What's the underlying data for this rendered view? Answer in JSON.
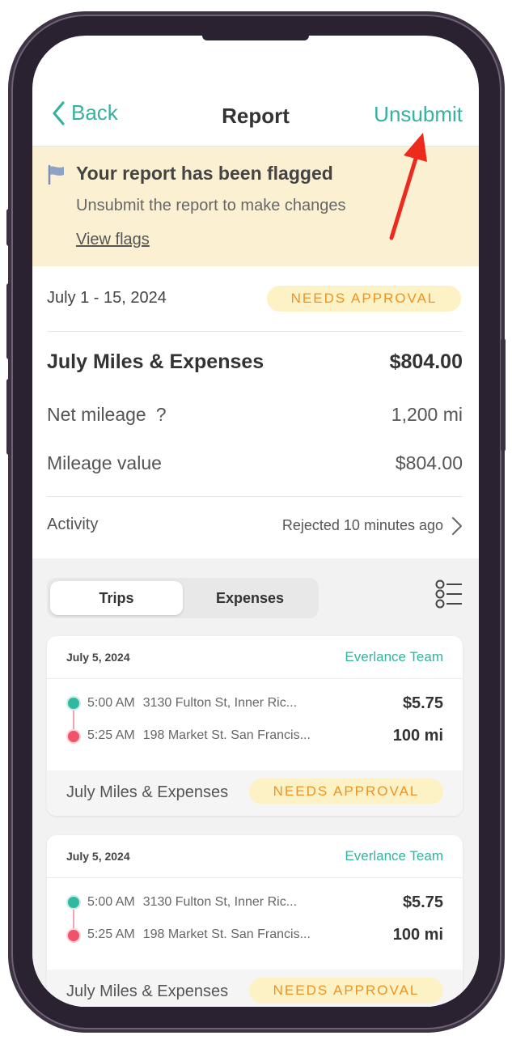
{
  "nav": {
    "back_label": "Back",
    "title": "Report",
    "unsubmit_label": "Unsubmit"
  },
  "flag_banner": {
    "title": "Your report has been flagged",
    "subtitle": "Unsubmit the report to make changes",
    "link": "View flags"
  },
  "report": {
    "date_range": "July 1 - 15, 2024",
    "status": "NEEDS APPROVAL",
    "name": "July Miles & Expenses",
    "total": "$804.00",
    "net_mileage_label": "Net mileage",
    "help_glyph": "?",
    "net_mileage_value": "1,200 mi",
    "mileage_value_label": "Mileage value",
    "mileage_value": "$804.00",
    "activity_label": "Activity",
    "activity_value": "Rejected 10 minutes ago"
  },
  "segments": {
    "trips": "Trips",
    "expenses": "Expenses",
    "active": "trips"
  },
  "trips": [
    {
      "date": "July 5, 2024",
      "team": "Everlance Team",
      "start_time": "5:00 AM",
      "start_address": "3130 Fulton St, Inner Ric...",
      "end_time": "5:25 AM",
      "end_address": "198 Market St. San Francis...",
      "amount": "$5.75",
      "distance": "100 mi",
      "report_name": "July Miles & Expenses",
      "status": "NEEDS APPROVAL"
    },
    {
      "date": "July 5, 2024",
      "team": "Everlance Team",
      "start_time": "5:00 AM",
      "start_address": "3130 Fulton St, Inner Ric...",
      "end_time": "5:25 AM",
      "end_address": "198 Market St. San Francis...",
      "amount": "$5.75",
      "distance": "100 mi",
      "report_name": "July Miles & Expenses",
      "status": "NEEDS APPROVAL"
    }
  ],
  "colors": {
    "accent": "#33b3a0",
    "banner_bg": "#fbf1d2",
    "badge_bg": "#fdf2c5",
    "badge_text": "#f0921e",
    "annotation_arrow": "#ee2a1f"
  },
  "icons": {
    "back": "chevron-left-icon",
    "flag": "flag-icon",
    "activity": "chevron-right-icon",
    "filter": "list-filter-icon"
  }
}
